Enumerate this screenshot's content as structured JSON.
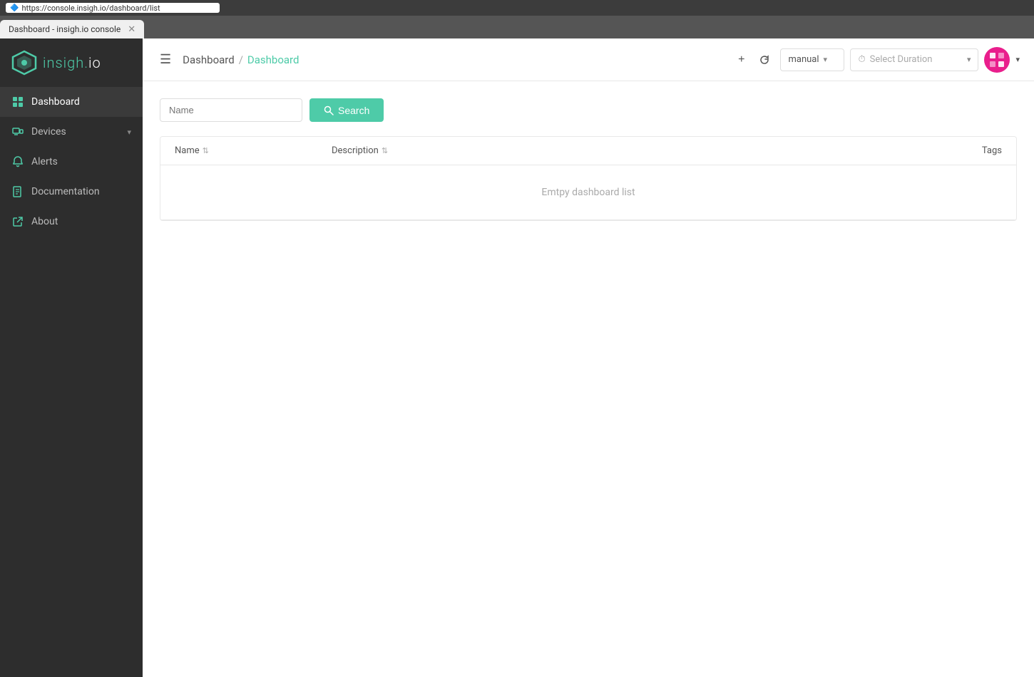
{
  "browser": {
    "url": "https://console.insigh.io/dashboard/list",
    "tab_title": "Dashboard - insigh.io console",
    "favicon": "🔷"
  },
  "sidebar": {
    "logo_text": "insigh.",
    "logo_suffix": "io",
    "nav_items": [
      {
        "id": "dashboard",
        "label": "Dashboard",
        "icon": "grid",
        "active": true
      },
      {
        "id": "devices",
        "label": "Devices",
        "icon": "devices",
        "has_chevron": true,
        "active": false
      },
      {
        "id": "alerts",
        "label": "Alerts",
        "icon": "bell",
        "active": false
      },
      {
        "id": "documentation",
        "label": "Documentation",
        "icon": "doc",
        "active": false
      },
      {
        "id": "about",
        "label": "About",
        "icon": "external",
        "active": false
      }
    ]
  },
  "header": {
    "breadcrumb_root": "Dashboard",
    "breadcrumb_current": "Dashboard",
    "manual_label": "manual",
    "duration_placeholder": "Select Duration",
    "add_tooltip": "Add",
    "refresh_tooltip": "Refresh"
  },
  "content": {
    "search_placeholder": "Name",
    "search_button": "Search",
    "table": {
      "columns": [
        "Name",
        "Description",
        "Tags"
      ],
      "empty_message": "Emtpy dashboard list"
    }
  }
}
